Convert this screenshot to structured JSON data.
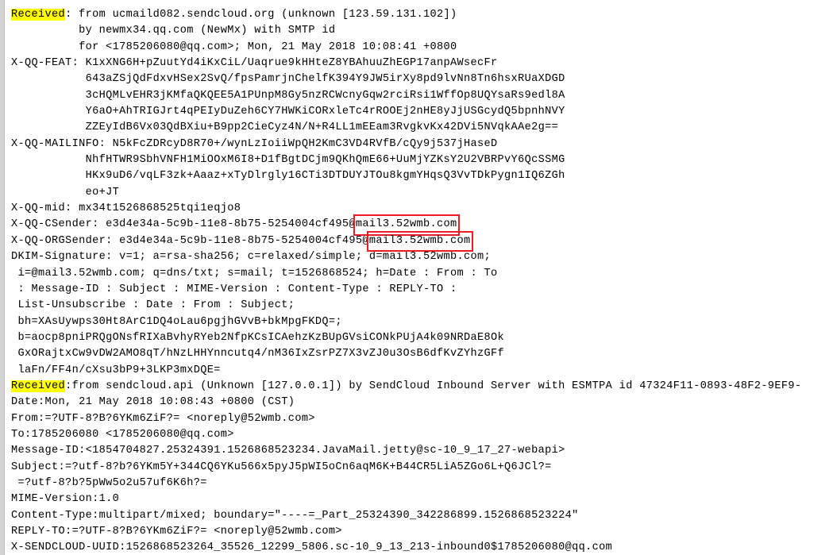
{
  "document": {
    "kind": "raw-email-header-source",
    "highlight_color": "#ffff00",
    "box_color": "#ee1c22",
    "text_color": "#000000",
    "background_color": "#ffffff"
  },
  "lines": [
    {
      "id": "received-1",
      "segments": [
        {
          "text": "Received",
          "style": "highlight"
        },
        {
          "text": ": from ucmaild082.sendcloud.org (unknown [123.59.131.102])",
          "style": "plain"
        }
      ]
    },
    {
      "id": "received-1-by",
      "segments": [
        {
          "text": "          by newmx34.qq.com (NewMx) with SMTP id",
          "style": "plain"
        }
      ]
    },
    {
      "id": "received-1-for",
      "segments": [
        {
          "text": "          for <1785206080@qq.com>; Mon, 21 May 2018 10:08:41 +0800",
          "style": "plain"
        }
      ]
    },
    {
      "id": "x-qq-feat",
      "segments": [
        {
          "text": "X-QQ-FEAT: K1xXNG6H+pZuutYd4iKxCiL/Uaqrue9kHHteZ8YBAhuuZhEGP17anpAWsecFr",
          "style": "plain"
        }
      ]
    },
    {
      "id": "x-qq-feat-2",
      "segments": [
        {
          "text": "           643aZSjQdFdxvHSex2SvQ/fpsPamrjnChelfK394Y9JW5irXy8pd9lvNn8Tn6hsxRUaXDGD",
          "style": "plain"
        }
      ]
    },
    {
      "id": "x-qq-feat-3",
      "segments": [
        {
          "text": "           3cHQMLvEHR3jKMfaQKQEE5A1PUnpM8Gy5nzRCWcnyGqw2rciRsi1WffOp8UQYsaRs9edl8A",
          "style": "plain"
        }
      ]
    },
    {
      "id": "x-qq-feat-4",
      "segments": [
        {
          "text": "           Y6aO+AhTRIGJrt4qPEIyDuZeh6CY7HWKiCORxleTc4rROOEj2nHE8yJjUSGcydQ5bpnhNVY",
          "style": "plain"
        }
      ]
    },
    {
      "id": "x-qq-feat-5",
      "segments": [
        {
          "text": "           ZZEyIdB6Vx03QdBXiu+B9pp2CieCyz4N/N+R4LL1mEEam3RvgkvKx42DVi5NVqkAAe2g==",
          "style": "plain"
        }
      ]
    },
    {
      "id": "x-qq-mailinfo",
      "segments": [
        {
          "text": "X-QQ-MAILINFO: N5kFcZDRcyD8R70+/wynLzIoiiWpQH2KmC3VD4RVfB/cQy9j537jHaseD",
          "style": "plain"
        }
      ]
    },
    {
      "id": "x-qq-mailinfo-2",
      "segments": [
        {
          "text": "           NhfHTWR9SbhVNFH1MiOOxM6I8+D1fBgtDCjm9QKhQmE66+UuMjYZKsY2U2VBRPvY6QcSSMG",
          "style": "plain"
        }
      ]
    },
    {
      "id": "x-qq-mailinfo-3",
      "segments": [
        {
          "text": "           HKx9uD6/vqLF3zk+Aaaz+xTyDlrgly16CTi3DTDUYJTOu8kgmYHqsQ3VvTDkPygn1IQ6ZGh",
          "style": "plain"
        }
      ]
    },
    {
      "id": "x-qq-mailinfo-4",
      "segments": [
        {
          "text": "           eo+JT",
          "style": "plain"
        }
      ]
    },
    {
      "id": "x-qq-mid",
      "segments": [
        {
          "text": "X-QQ-mid: mx34t1526868525tqi1eqjo8",
          "style": "plain"
        }
      ]
    },
    {
      "id": "x-qq-csender",
      "segments": [
        {
          "text": "X-QQ-CSender: e3d4e34a-5c9b-11e8-8b75-5254004cf495@",
          "style": "plain"
        },
        {
          "text": "mail3.52wmb.com",
          "style": "box"
        }
      ]
    },
    {
      "id": "x-qq-orgsender",
      "segments": [
        {
          "text": "X-QQ-ORGSender: e3d4e34a-5c9b-11e8-8b75-5254004cf495@",
          "style": "plain"
        },
        {
          "text": "mail3.52wmb.com",
          "style": "box"
        }
      ]
    },
    {
      "id": "dkim-signature",
      "segments": [
        {
          "text": "DKIM-Signature: v=1; a=rsa-sha256; c=relaxed/simple; d=mail3.52wmb.com;",
          "style": "plain"
        }
      ]
    },
    {
      "id": "dkim-i",
      "segments": [
        {
          "text": " i=@mail3.52wmb.com; q=dns/txt; s=mail; t=1526868524; h=Date : From : To",
          "style": "plain"
        }
      ]
    },
    {
      "id": "dkim-h2",
      "segments": [
        {
          "text": " : Message-ID : Subject : MIME-Version : Content-Type : REPLY-TO :",
          "style": "plain"
        }
      ]
    },
    {
      "id": "dkim-h3",
      "segments": [
        {
          "text": " List-Unsubscribe : Date : From : Subject;",
          "style": "plain"
        }
      ]
    },
    {
      "id": "dkim-bh",
      "segments": [
        {
          "text": " bh=XAsUywps30Ht8ArC1DQ4oLau6pgjhGVvB+bkMpgFKDQ=;",
          "style": "plain"
        }
      ]
    },
    {
      "id": "dkim-b",
      "segments": [
        {
          "text": " b=aocp8pniPRQgONsfRIXaBvhyRYeb2NfpKCsICAehzKzBUpGVsiCONkPUjA4k09NRDaE8Ok",
          "style": "plain"
        }
      ]
    },
    {
      "id": "dkim-b2",
      "segments": [
        {
          "text": " GxORajtxCw9vDW2AMO8qT/hNzLHHYnncutq4/nM36IxZsrPZ7X3vZJ0u3OsB6dfKvZYhzGFf",
          "style": "plain"
        }
      ]
    },
    {
      "id": "dkim-b3",
      "segments": [
        {
          "text": " laFn/FF4n/cXsu3bP9+3LKP3mxDQE=",
          "style": "plain"
        }
      ]
    },
    {
      "id": "received-2",
      "segments": [
        {
          "text": "Received",
          "style": "highlight"
        },
        {
          "text": ":from sendcloud.api (Unknown [127.0.0.1]) by SendCloud Inbound Server with ESMTPA id 47324F11-0893-48F2-9EF9-",
          "style": "plain"
        }
      ]
    },
    {
      "id": "date",
      "segments": [
        {
          "text": "Date:Mon, 21 May 2018 10:08:43 +0800 (CST)",
          "style": "plain"
        }
      ]
    },
    {
      "id": "from",
      "segments": [
        {
          "text": "From:=?UTF-8?B?6YKm6ZiF?= <noreply@52wmb.com>",
          "style": "plain"
        }
      ]
    },
    {
      "id": "to",
      "segments": [
        {
          "text": "To:1785206080 <1785206080@qq.com>",
          "style": "plain"
        }
      ]
    },
    {
      "id": "message-id",
      "segments": [
        {
          "text": "Message-ID:<1854704827.25324391.1526868523234.JavaMail.jetty@sc-10_9_17_27-webapi>",
          "style": "plain"
        }
      ]
    },
    {
      "id": "subject",
      "segments": [
        {
          "text": "Subject:=?utf-8?b?6YKm5Y+344CQ6YKu566x5pyJ5pWI5oCn6aqM6K+B44CR5LiA5ZGo6L+Q6JCl?=",
          "style": "plain"
        }
      ]
    },
    {
      "id": "subject-2",
      "segments": [
        {
          "text": " =?utf-8?b?5pWw5o2u57uf6K6h?=",
          "style": "plain"
        }
      ]
    },
    {
      "id": "mime-version",
      "segments": [
        {
          "text": "MIME-Version:1.0",
          "style": "plain"
        }
      ]
    },
    {
      "id": "content-type",
      "segments": [
        {
          "text": "Content-Type:multipart/mixed; boundary=\"----=_Part_25324390_342286899.1526868523224\"",
          "style": "plain"
        }
      ]
    },
    {
      "id": "reply-to",
      "segments": [
        {
          "text": "REPLY-TO:=?UTF-8?B?6YKm6ZiF?= <noreply@52wmb.com>",
          "style": "plain"
        }
      ]
    },
    {
      "id": "x-sendcloud-uuid",
      "segments": [
        {
          "text": "X-SENDCLOUD-UUID:1526868523264_35526_12299_5806.sc-10_9_13_213-inbound0$1785206080@qq.com",
          "style": "plain"
        }
      ]
    }
  ]
}
